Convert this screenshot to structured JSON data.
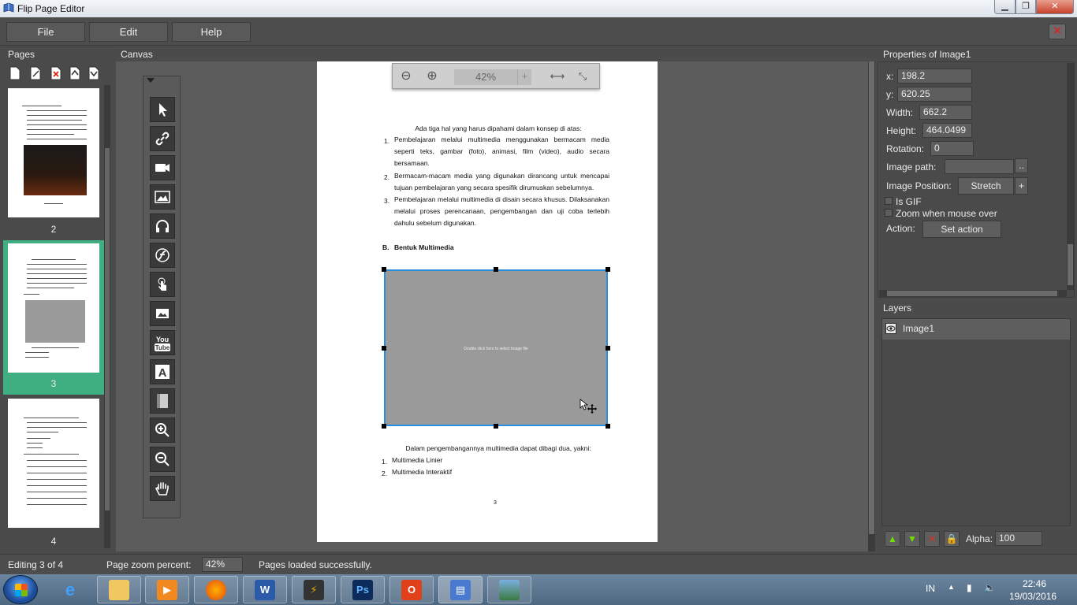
{
  "window": {
    "title": "Flip Page Editor"
  },
  "menu": {
    "file": "File",
    "edit": "Edit",
    "help": "Help"
  },
  "panels": {
    "pages": "Pages",
    "canvas": "Canvas",
    "properties": "Properties of Image1",
    "layers": "Layers"
  },
  "pages": [
    {
      "number": "2",
      "selected": false
    },
    {
      "number": "3",
      "selected": true
    },
    {
      "number": "4",
      "selected": false
    }
  ],
  "zoombar": {
    "value": "42%",
    "plus": "+"
  },
  "document": {
    "intro": "Ada tiga hal yang harus dipahami dalam konsep di atas:",
    "points": [
      {
        "num": "1.",
        "text": "Pembelajaran melalui multimedia menggunakan bermacam media seperti teks, gambar (foto), animasi, film (video), audio secara bersamaan."
      },
      {
        "num": "2.",
        "text": "Bermacam-macam media yang digunakan dirancang untuk mencapai tujuan pembelajaran yang secara spesifik dirumuskan sebelumnya."
      },
      {
        "num": "3.",
        "text": "Pembelajaran melalui multimedia di disain secara khusus. Dilaksanakan melalui proses perencanaan, pengembangan dan uji coba terlebih dahulu sebelum digunakan."
      }
    ],
    "section_letter": "B.",
    "section_title": "Bentuk Multimedia",
    "image_hint": "Double click here to select Image file",
    "outro": "Dalam pengembangannya multimedia dapat dibagi dua, yakni:",
    "types": [
      {
        "num": "1.",
        "text": "Multimedia Linier"
      },
      {
        "num": "2.",
        "text": "Multimedia Interaktif"
      }
    ],
    "page_number": "3"
  },
  "properties": {
    "x_label": "x:",
    "x_value": "198.2",
    "y_label": "y:",
    "y_value": "620.25",
    "width_label": "Width:",
    "width_value": "662.2",
    "height_label": "Height:",
    "height_value": "464.0499",
    "rotation_label": "Rotation:",
    "rotation_value": "0",
    "image_path_label": "Image path:",
    "image_path_value": "",
    "browse": "..",
    "image_position_label": "Image Position:",
    "image_position_value": "Stretch",
    "image_position_plus": "+",
    "is_gif_label": "Is GIF",
    "zoom_label": "Zoom when mouse over",
    "action_label": "Action:",
    "action_button": "Set action"
  },
  "layers": {
    "items": [
      {
        "name": "Image1"
      }
    ],
    "alpha_label": "Alpha:",
    "alpha_value": "100"
  },
  "status": {
    "editing": "Editing 3 of 4",
    "zoom_label": "Page zoom percent:",
    "zoom_value": "42%",
    "message": "Pages loaded successfully."
  },
  "taskbar": {
    "lang": "IN",
    "time": "22:46",
    "date": "19/03/2016"
  },
  "colors": {
    "selection": "#2a8fe0",
    "selected_page": "#3fae80"
  }
}
